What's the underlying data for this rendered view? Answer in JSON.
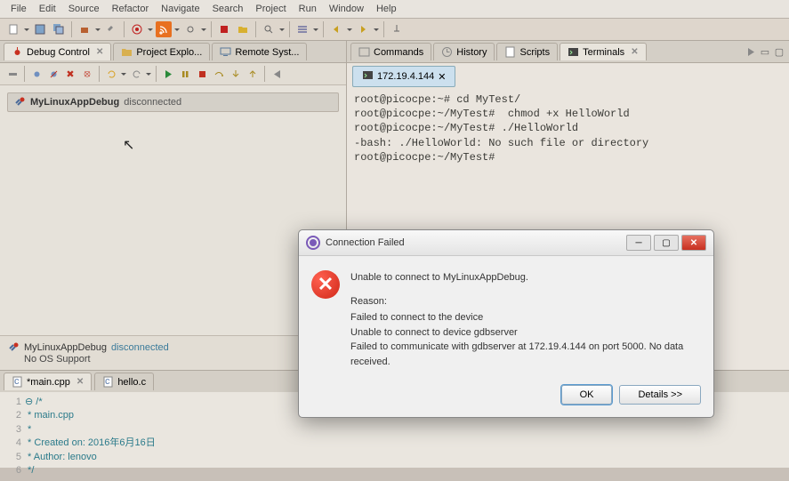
{
  "menu": [
    "File",
    "Edit",
    "Source",
    "Refactor",
    "Navigate",
    "Search",
    "Project",
    "Run",
    "Window",
    "Help"
  ],
  "left_panel": {
    "tabs": [
      {
        "label": "Debug Control",
        "active": true,
        "icon": "bug"
      },
      {
        "label": "Project Explo...",
        "active": false,
        "icon": "folder"
      },
      {
        "label": "Remote Syst...",
        "active": false,
        "icon": "monitor"
      }
    ],
    "debug_item": {
      "name": "MyLinuxAppDebug",
      "status": "disconnected"
    },
    "status": {
      "name": "MyLinuxAppDebug",
      "conn": "disconnected",
      "sub": "No OS Support"
    }
  },
  "right_panel": {
    "tabs": [
      {
        "label": "Commands",
        "icon": "cmd"
      },
      {
        "label": "History",
        "icon": "hist"
      },
      {
        "label": "Scripts",
        "icon": "script"
      },
      {
        "label": "Terminals",
        "icon": "term",
        "active": true
      }
    ],
    "session": "172.19.4.144",
    "terminal": "root@picocpe:~# cd MyTest/\nroot@picocpe:~/MyTest#  chmod +x HelloWorld\nroot@picocpe:~/MyTest# ./HelloWorld\n-bash: ./HelloWorld: No such file or directory\nroot@picocpe:~/MyTest#"
  },
  "editor": {
    "tabs": [
      {
        "label": "*main.cpp",
        "active": true
      },
      {
        "label": "hello.c",
        "active": false
      }
    ],
    "lines": [
      {
        "n": "1",
        "t": "/*",
        "marker": "⊖"
      },
      {
        "n": "2",
        "t": " * main.cpp"
      },
      {
        "n": "3",
        "t": " *"
      },
      {
        "n": "4",
        "t": " *  Created on: 2016年6月16日"
      },
      {
        "n": "5",
        "t": " *      Author: lenovo"
      },
      {
        "n": "6",
        "t": " */"
      }
    ]
  },
  "dialog": {
    "title": "Connection Failed",
    "heading": "Unable to connect to MyLinuxAppDebug.",
    "reason_label": "Reason:",
    "reasons": [
      "Failed to connect to the device",
      "Unable to connect to device gdbserver",
      "Failed to communicate with gdbserver at 172.19.4.144 on port 5000. No data received."
    ],
    "ok": "OK",
    "details": "Details >>"
  }
}
